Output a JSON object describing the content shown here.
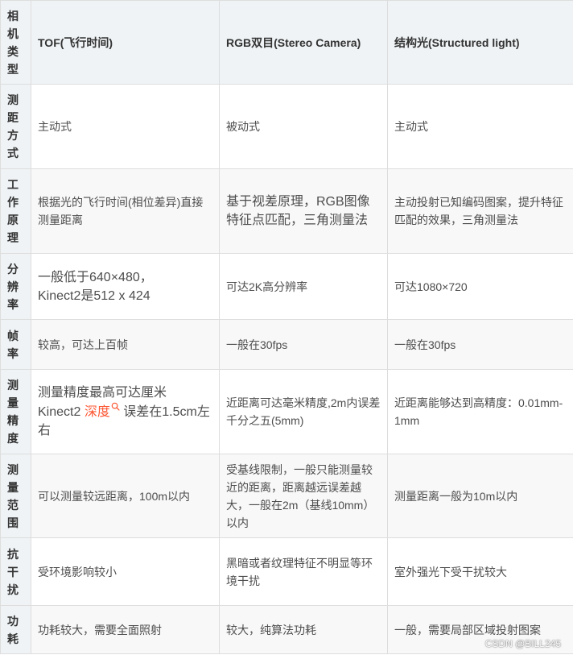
{
  "colors": {
    "header_bg": "#eff3f5",
    "stripe_bg": "#f8f8f8",
    "border": "#dddddd",
    "link": "#fc5531",
    "text": "#4d4d4d",
    "heading_text": "#333333"
  },
  "table": {
    "header": {
      "label": "相机类型",
      "columns": [
        "TOF(飞行时间)",
        "RGB双目(Stereo Camera)",
        "结构光(Structured light)"
      ]
    },
    "rows": [
      {
        "label": "测距方式",
        "cells": [
          {
            "lines": [
              "主动式"
            ]
          },
          {
            "lines": [
              "被动式"
            ]
          },
          {
            "lines": [
              "主动式"
            ]
          }
        ]
      },
      {
        "label": "工作原理",
        "cells": [
          {
            "lines": [
              "根据光的飞行时间(相位差异)直接",
              "测量距离"
            ]
          },
          {
            "lines": [
              "基于视差原理，RGB图像",
              "特征点匹配，三角测量法"
            ]
          },
          {
            "lines": [
              "主动投射已知编码图案，提升特征",
              "匹配的效果，三角测量法"
            ]
          }
        ]
      },
      {
        "label": "分辨率",
        "cells": [
          {
            "lines": [
              "一般低于640×480，",
              "Kinect2是512 x 424"
            ]
          },
          {
            "lines": [
              "可达2K高分辨率"
            ]
          },
          {
            "lines": [
              "可达1080×720"
            ]
          }
        ]
      },
      {
        "label": "帧率",
        "cells": [
          {
            "lines": [
              "较高，可达上百帧"
            ]
          },
          {
            "lines": [
              "一般在30fps"
            ]
          },
          {
            "lines": [
              "一般在30fps"
            ]
          }
        ]
      },
      {
        "label": "测量精度",
        "cells": [
          {
            "lines": [
              "测量精度最高可达厘米"
            ],
            "before_link": "Kinect2 ",
            "link": "深度",
            "link_icon": "search-icon",
            "after_link": " 误差在1.5cm左右"
          },
          {
            "lines": [
              "近距离可达毫米精度,2m内误差",
              "千分之五(5mm)"
            ]
          },
          {
            "lines": [
              "近距离能够达到高精度：0.01mm-",
              "1mm"
            ]
          }
        ]
      },
      {
        "label": "测量范围",
        "cells": [
          {
            "lines": [
              "可以测量较远距离，100m以内"
            ]
          },
          {
            "lines": [
              "受基线限制，一般只能测量较",
              "近的距离，距离越远误差越",
              "大，一般在2m（基线10mm）",
              "以内"
            ]
          },
          {
            "lines": [
              "测量距离一般为10m以内"
            ]
          }
        ]
      },
      {
        "label": "抗干扰",
        "cells": [
          {
            "lines": [
              "受环境影响较小"
            ]
          },
          {
            "lines": [
              "黑暗或者纹理特征不明显等环",
              "境干扰"
            ]
          },
          {
            "lines": [
              "室外强光下受干扰较大"
            ]
          }
        ]
      },
      {
        "label": "功耗",
        "cells": [
          {
            "lines": [
              "功耗较大，需要全面照射"
            ]
          },
          {
            "lines": [
              "较大，纯算法功耗"
            ]
          },
          {
            "lines": [
              "一般，需要局部区域投射图案"
            ]
          }
        ]
      }
    ]
  },
  "watermark": "CSDN @BILL245"
}
